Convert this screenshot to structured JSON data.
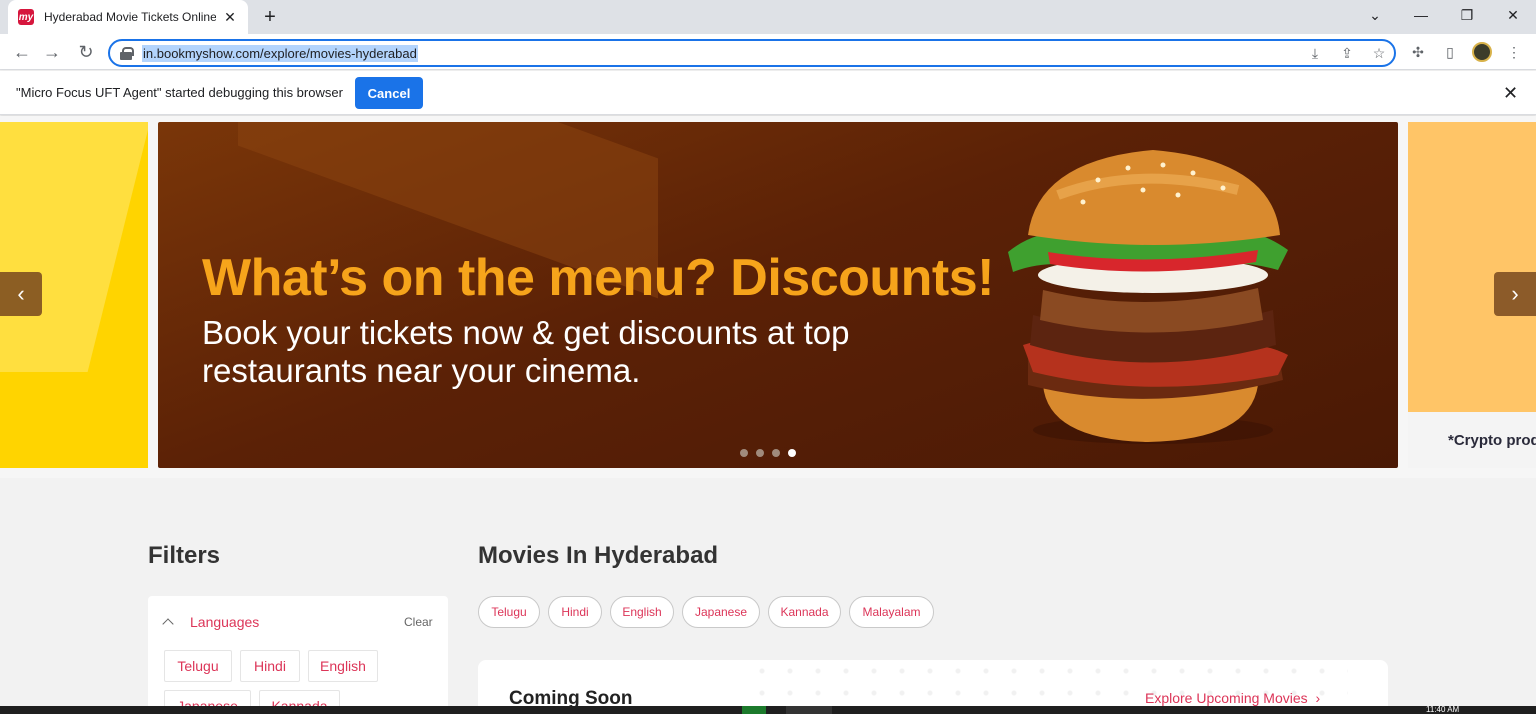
{
  "browser": {
    "tab_title": "Hyderabad Movie Tickets Online",
    "favicon_text": "my",
    "url": "in.bookmyshow.com/explore/movies-hyderabad"
  },
  "infobar": {
    "message": "\"Micro Focus UFT Agent\" started debugging this browser",
    "cancel_label": "Cancel"
  },
  "carousel": {
    "headline": "What’s on the menu? Discounts!",
    "subtext": "Book your tickets now & get discounts at top restaurants near your cinema.",
    "right_slide_text": "*Crypto produ",
    "dot_count": 4,
    "active_dot": 4
  },
  "filters": {
    "title": "Filters",
    "languages_label": "Languages",
    "clear_label": "Clear",
    "chips": [
      "Telugu",
      "Hindi",
      "English",
      "Japanese",
      "Kannada"
    ]
  },
  "movies": {
    "title": "Movies In Hyderabad",
    "language_pills": [
      "Telugu",
      "Hindi",
      "English",
      "Japanese",
      "Kannada",
      "Malayalam"
    ],
    "coming_soon_title": "Coming Soon",
    "explore_link": "Explore Upcoming Movies",
    "explore_chevron": "›"
  },
  "taskbar": {
    "clock": "11:40 AM"
  },
  "colors": {
    "brand_red": "#dc3558",
    "promo_orange": "#f6a41b",
    "chrome_blue": "#1a73e8"
  }
}
